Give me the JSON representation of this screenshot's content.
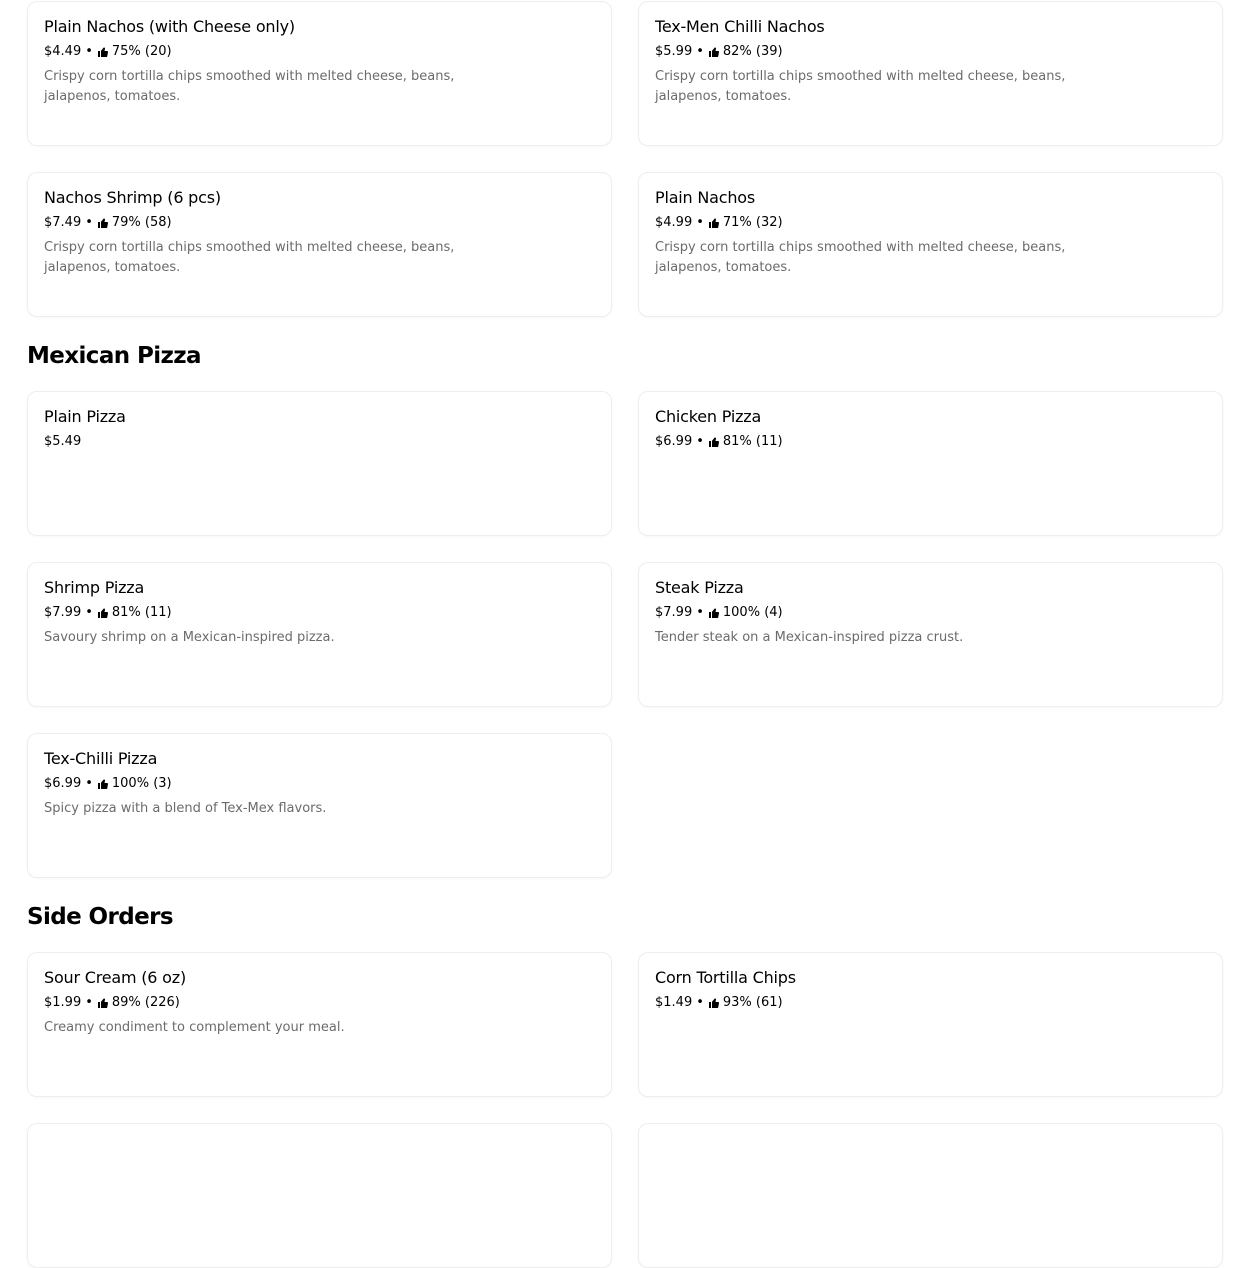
{
  "sections": {
    "nachos": {
      "items": [
        {
          "name": "Plain Nachos (with Cheese only)",
          "price": "$4.49",
          "rating": "75% (20)",
          "description": "Crispy corn tortilla chips smoothed with melted cheese, beans, jalapenos, tomatoes."
        },
        {
          "name": "Tex-Men Chilli Nachos",
          "price": "$5.99",
          "rating": "82% (39)",
          "description": "Crispy corn tortilla chips smoothed with melted cheese, beans, jalapenos, tomatoes."
        },
        {
          "name": "Nachos Shrimp (6 pcs)",
          "price": "$7.49",
          "rating": "79% (58)",
          "description": "Crispy corn tortilla chips smoothed with melted cheese, beans, jalapenos, tomatoes."
        },
        {
          "name": "Plain Nachos",
          "price": "$4.99",
          "rating": "71% (32)",
          "description": "Crispy corn tortilla chips smoothed with melted cheese, beans, jalapenos, tomatoes."
        }
      ]
    },
    "mexican_pizza": {
      "title": "Mexican Pizza",
      "items": [
        {
          "name": "Plain Pizza",
          "price": "$5.49",
          "rating": "",
          "description": ""
        },
        {
          "name": "Chicken Pizza",
          "price": "$6.99",
          "rating": "81% (11)",
          "description": ""
        },
        {
          "name": "Shrimp Pizza",
          "price": "$7.99",
          "rating": "81% (11)",
          "description": "Savoury shrimp on a Mexican-inspired pizza."
        },
        {
          "name": "Steak Pizza",
          "price": "$7.99",
          "rating": "100% (4)",
          "description": "Tender steak on a Mexican-inspired pizza crust."
        },
        {
          "name": "Tex-Chilli Pizza",
          "price": "$6.99",
          "rating": "100% (3)",
          "description": "Spicy pizza with a blend of Tex-Mex flavors."
        }
      ]
    },
    "side_orders": {
      "title": "Side Orders",
      "items": [
        {
          "name": "Sour Cream (6 oz)",
          "price": "$1.99",
          "rating": "89% (226)",
          "description": "Creamy condiment to complement your meal."
        },
        {
          "name": "Corn Tortilla Chips",
          "price": "$1.49",
          "rating": "93% (61)",
          "description": ""
        },
        {
          "name": "",
          "price": "",
          "rating": "",
          "description": ""
        },
        {
          "name": "",
          "price": "",
          "rating": "",
          "description": ""
        }
      ]
    }
  },
  "meta_separator": "•",
  "icons": {
    "rating": "thumbs-up-icon"
  },
  "colors": {
    "text": "#000000",
    "muted": "#6b6b6b",
    "border": "#eeeeee"
  }
}
